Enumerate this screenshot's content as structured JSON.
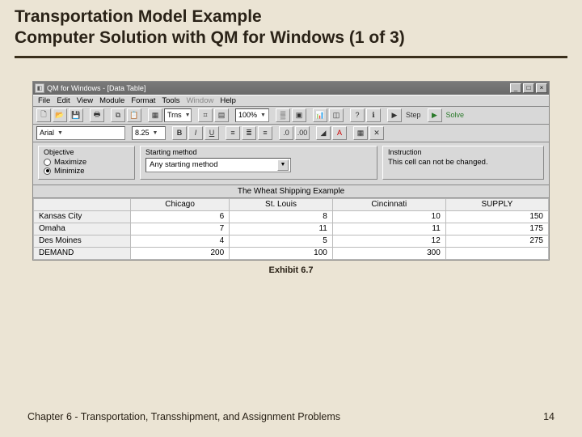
{
  "slide": {
    "title_line1": "Transportation Model Example",
    "title_line2": "Computer Solution with QM for Windows (1 of 3)",
    "caption": "Exhibit 6.7",
    "footer_left": "Chapter 6 - Transportation, Transshipment, and Assignment Problems",
    "footer_right": "14"
  },
  "app": {
    "title": "QM for Windows - [Data Table]",
    "menus": [
      "File",
      "Edit",
      "View",
      "Module",
      "Format",
      "Tools",
      "Window",
      "Help"
    ],
    "zoom": "100%",
    "step_label": "Step",
    "solve_label": "Solve",
    "font_name": "Arial",
    "font_size": "8.25"
  },
  "objective_panel": {
    "title": "Objective",
    "options": [
      "Maximize",
      "Minimize"
    ],
    "selected": "Minimize"
  },
  "starting_panel": {
    "title": "Starting method",
    "value": "Any starting method"
  },
  "instruction_panel": {
    "title": "Instruction",
    "text": "This cell can not be changed."
  },
  "sheet": {
    "title": "The Wheat Shipping Example",
    "columns": [
      "",
      "Chicago",
      "St. Louis",
      "Cincinnati",
      "SUPPLY"
    ],
    "rows": [
      {
        "head": "Kansas City",
        "cells": [
          "6",
          "8",
          "10",
          "150"
        ]
      },
      {
        "head": "Omaha",
        "cells": [
          "7",
          "11",
          "11",
          "175"
        ]
      },
      {
        "head": "Des Moines",
        "cells": [
          "4",
          "5",
          "12",
          "275"
        ]
      },
      {
        "head": "DEMAND",
        "cells": [
          "200",
          "100",
          "300",
          ""
        ]
      }
    ]
  },
  "chart_data": {
    "type": "table",
    "title": "The Wheat Shipping Example",
    "row_labels": [
      "Kansas City",
      "Omaha",
      "Des Moines"
    ],
    "col_labels": [
      "Chicago",
      "St. Louis",
      "Cincinnati"
    ],
    "cost_matrix": [
      [
        6,
        8,
        10
      ],
      [
        7,
        11,
        11
      ],
      [
        4,
        5,
        12
      ]
    ],
    "supply": [
      150,
      175,
      275
    ],
    "demand": [
      200,
      100,
      300
    ],
    "objective": "Minimize"
  }
}
